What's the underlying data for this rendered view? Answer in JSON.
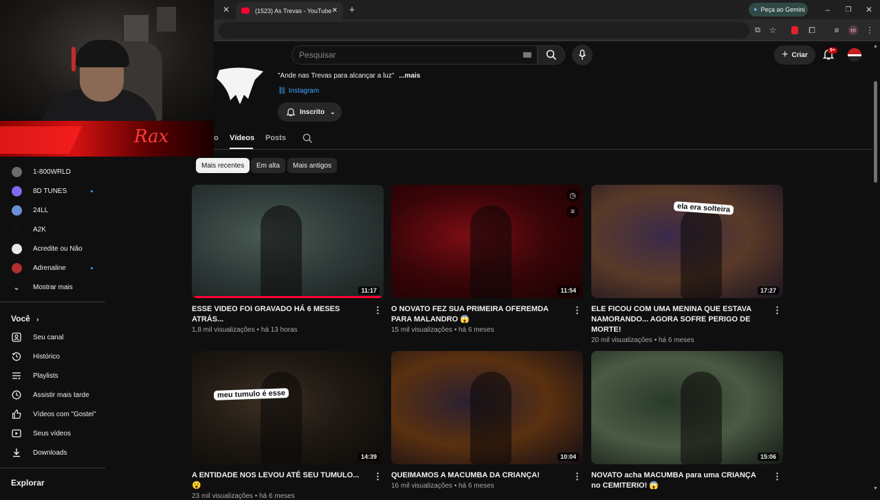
{
  "browser": {
    "tab_title": "(1523) As Trevas - YouTube",
    "gemini_label": "Peça ao Gemini",
    "profile_initial": "m"
  },
  "header": {
    "search_placeholder": "Pesquisar",
    "create_label": "Criar",
    "notifications_badge": "9+"
  },
  "channel": {
    "description": "\"Ande nas Trevas para alcançar a luz\"",
    "more_label": "...mais",
    "link_label": "Instagram",
    "subscribed_label": "Inscrito",
    "tabs": [
      {
        "label": "o"
      },
      {
        "label": "Vídeos"
      },
      {
        "label": "Posts"
      }
    ]
  },
  "filters": [
    "Mais recentes",
    "Em alta",
    "Mais antigos"
  ],
  "sidebar": {
    "subscriptions": [
      {
        "label": "1-800WRLD",
        "color": "#6b6b6b",
        "dot": false
      },
      {
        "label": "8D TUNES",
        "color": "#7b6cf0",
        "dot": true
      },
      {
        "label": "24LL",
        "color": "#6c8fd9",
        "dot": false
      },
      {
        "label": "A2K",
        "color": "#111111",
        "dot": false
      },
      {
        "label": "Acredite ou Não",
        "color": "#e8e8e8",
        "dot": false
      },
      {
        "label": "Adrenaline",
        "color": "#b03030",
        "dot": true
      }
    ],
    "show_more": "Mostrar mais",
    "you_heading": "Você",
    "you_items": [
      {
        "label": "Seu canal",
        "icon": "person-box-icon"
      },
      {
        "label": "Histórico",
        "icon": "history-icon"
      },
      {
        "label": "Playlists",
        "icon": "playlist-icon"
      },
      {
        "label": "Assistir mais tarde",
        "icon": "clock-icon"
      },
      {
        "label": "Vídeos com \"Gostei\"",
        "icon": "thumbs-up-icon"
      },
      {
        "label": "Seus vídeos",
        "icon": "play-box-icon"
      },
      {
        "label": "Downloads",
        "icon": "download-icon"
      }
    ],
    "explore_heading": "Explorar"
  },
  "webcam": {
    "banner_text": "Rax"
  },
  "videos": [
    {
      "title": "ESSE VIDEO FOI GRAVADO HÁ 6 MESES ATRÁS...",
      "views": "1,8 mil visualizações",
      "age": "há 13 horas",
      "duration": "11:17",
      "watched_fraction": 1.0,
      "colors": [
        "#4a5a55",
        "#2e3a38",
        "#1a1f1e"
      ]
    },
    {
      "title": "O NOVATO FEZ SUA PRIMEIRA OFEREMDA PARA MALANDRO 😱",
      "views": "15 mil visualizações",
      "age": "há 6 meses",
      "duration": "11:54",
      "watched_fraction": 0,
      "colors": [
        "#7a0d14",
        "#3a0508",
        "#1a0203"
      ]
    },
    {
      "title": "ELE FICOU COM UMA MENINA QUE ESTAVA NAMORANDO... AGORA SOFRE PERIGO DE MORTE!",
      "views": "20 mil visualizações",
      "age": "há 6 meses",
      "duration": "17:27",
      "watched_fraction": 0,
      "overlay_text": "ela era solteira",
      "colors": [
        "#3a2a4a",
        "#5a3a28",
        "#1a1420"
      ]
    },
    {
      "title": "A ENTIDADE NOS LEVOU ATÉ SEU TUMULO... 😮",
      "views": "23 mil visualizações",
      "age": "há 6 meses",
      "duration": "14:39",
      "watched_fraction": 0,
      "overlay_text": "meu tumulo é esse",
      "colors": [
        "#3a2e22",
        "#1e1812",
        "#0e0b08"
      ]
    },
    {
      "title": "QUEIMAMOS A MACUMBA DA CRIANÇA!",
      "views": "16 mil visualizações",
      "age": "há 6 meses",
      "duration": "10:04",
      "watched_fraction": 0,
      "colors": [
        "#2a2030",
        "#5a3010",
        "#120e14"
      ]
    },
    {
      "title": "NOVATO acha MACUMBA para uma CRIANÇA no CEMITERIO! 😱",
      "views": "",
      "age": "",
      "duration": "15:06",
      "watched_fraction": 0,
      "colors": [
        "#2a3a2a",
        "#4a5a44",
        "#141a14"
      ]
    }
  ],
  "colors": {
    "accent_red": "#ff0033",
    "link_blue": "#3ea6ff"
  }
}
